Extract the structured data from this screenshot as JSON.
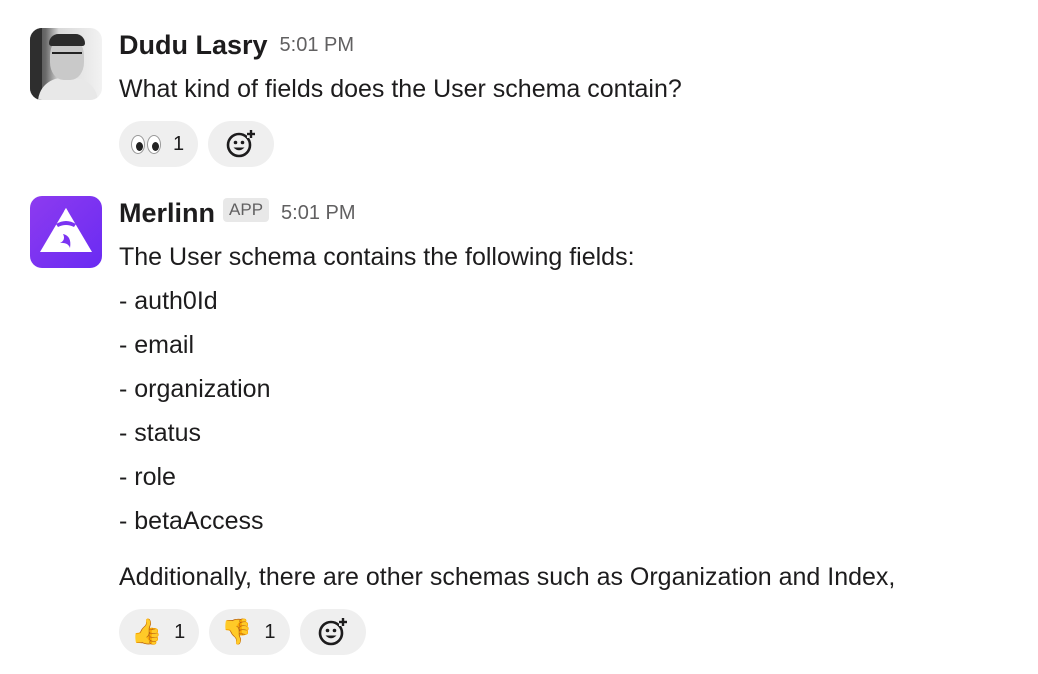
{
  "messages": [
    {
      "sender": "Dudu Lasry",
      "time": "5:01 PM",
      "avatar_icon": "profile-photo",
      "text": "What kind of fields does the User schema contain?",
      "reactions": [
        {
          "emoji": "eyes",
          "count": "1"
        }
      ]
    },
    {
      "sender": "Merlinn",
      "badge": "APP",
      "time": "5:01 PM",
      "avatar_icon": "wizard-hat-logo",
      "lines": [
        "The User schema contains the following fields:",
        "- auth0Id",
        "- email",
        "- organization",
        "- status",
        "- role",
        "- betaAccess"
      ],
      "extra": "Additionally, there are other schemas such as Organization and Index,",
      "reactions": [
        {
          "emoji": "👍",
          "count": "1"
        },
        {
          "emoji": "👎",
          "count": "1"
        }
      ]
    }
  ],
  "colors": {
    "text": "#1d1c1d",
    "muted": "#616061",
    "pill_bg": "#efefef",
    "app_avatar": "#7b33f2"
  }
}
